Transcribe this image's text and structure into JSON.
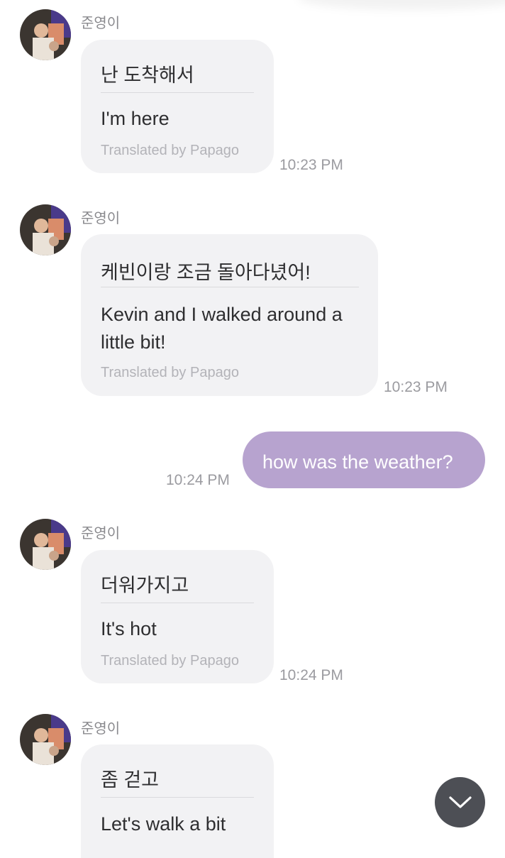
{
  "messages": [
    {
      "sender": "준영이",
      "original": "난 도착해서",
      "translation": "I'm here",
      "credit": "Translated by Papago",
      "time": "10:23 PM"
    },
    {
      "sender": "준영이",
      "original": "케빈이랑 조금 돌아다녔어!",
      "translation_lines": [
        "Kevin and I walked around a",
        "little bit!"
      ],
      "credit": "Translated by Papago",
      "time": "10:23 PM"
    },
    {
      "outgoing_text": "how was the weather?",
      "time": "10:24 PM"
    },
    {
      "sender": "준영이",
      "original": "더워가지고",
      "translation": "It's hot",
      "credit": "Translated by Papago",
      "time": "10:24 PM"
    },
    {
      "sender": "준영이",
      "original": "좀 걷고",
      "translation": "Let's walk a bit"
    }
  ],
  "colors": {
    "outgoing_bubble": "#b7a3cf",
    "incoming_bubble": "#f2f2f4",
    "scroll_button": "#4d4f55"
  },
  "icons": {
    "scroll_down": "chevron-down-icon",
    "avatar": "avatar"
  }
}
